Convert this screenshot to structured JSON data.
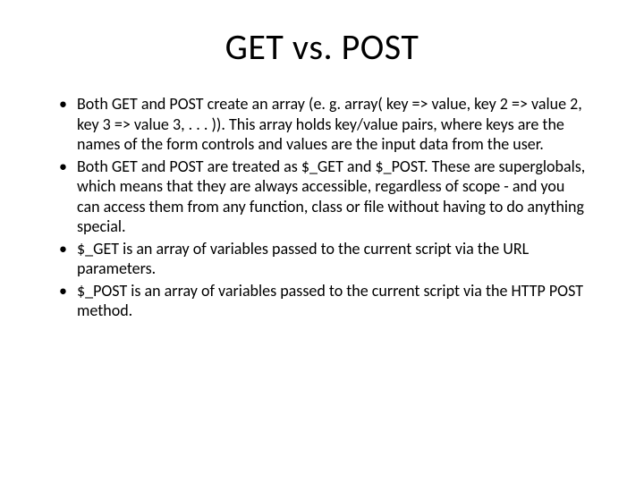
{
  "slide": {
    "title": "GET vs. POST",
    "bullets": [
      "Both GET and POST create an array (e. g. array( key => value, key 2 => value 2, key 3 => value 3, . . . )). This array holds key/value pairs, where keys are the names of the form controls and values are the input data from the user.",
      "Both GET and POST are treated as $_GET and $_POST. These are superglobals, which means that they are always accessible, regardless of scope - and you can access them from any function, class or file without having to do anything special.",
      "$_GET is an array of variables passed to the current script via the URL parameters.",
      "$_POST is an array of variables passed to the current script via the HTTP POST method."
    ]
  }
}
